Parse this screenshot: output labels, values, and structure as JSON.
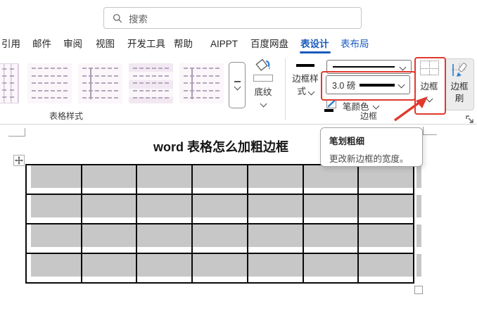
{
  "search": {
    "placeholder": "搜索"
  },
  "tabs": {
    "items": [
      {
        "label": "引用"
      },
      {
        "label": "邮件"
      },
      {
        "label": "审阅"
      },
      {
        "label": "视图"
      },
      {
        "label": "开发工具"
      },
      {
        "label": "帮助"
      },
      {
        "label": "AIPPT"
      },
      {
        "label": "百度网盘"
      },
      {
        "label": "表设计"
      },
      {
        "label": "表布局"
      }
    ],
    "active": "表设计"
  },
  "ribbon": {
    "table_styles": {
      "group_label": "表格样式",
      "styles": [
        "grid-table",
        "plain-rows",
        "header-column",
        "banded-rows",
        "header-column-2"
      ]
    },
    "shading": {
      "label": "底纹"
    },
    "border_style_button": {
      "label": "边框样式"
    },
    "line_weight_combo": {
      "selected": "3.0 磅"
    },
    "pen_color": {
      "label": "笔颜色",
      "color": "#000000"
    },
    "borders_button": {
      "label": "边框"
    },
    "border_painter": {
      "label": "边框刷"
    },
    "borders_group_label": "边框"
  },
  "tooltip": {
    "title": "笔划粗细",
    "body": "更改新边框的宽度。"
  },
  "document": {
    "title": "word 表格怎么加粗边框",
    "table": {
      "rows": 4,
      "cols": 7,
      "fill_color": "#c7c7c7"
    }
  },
  "annotation": {
    "color": "#e1392d"
  }
}
